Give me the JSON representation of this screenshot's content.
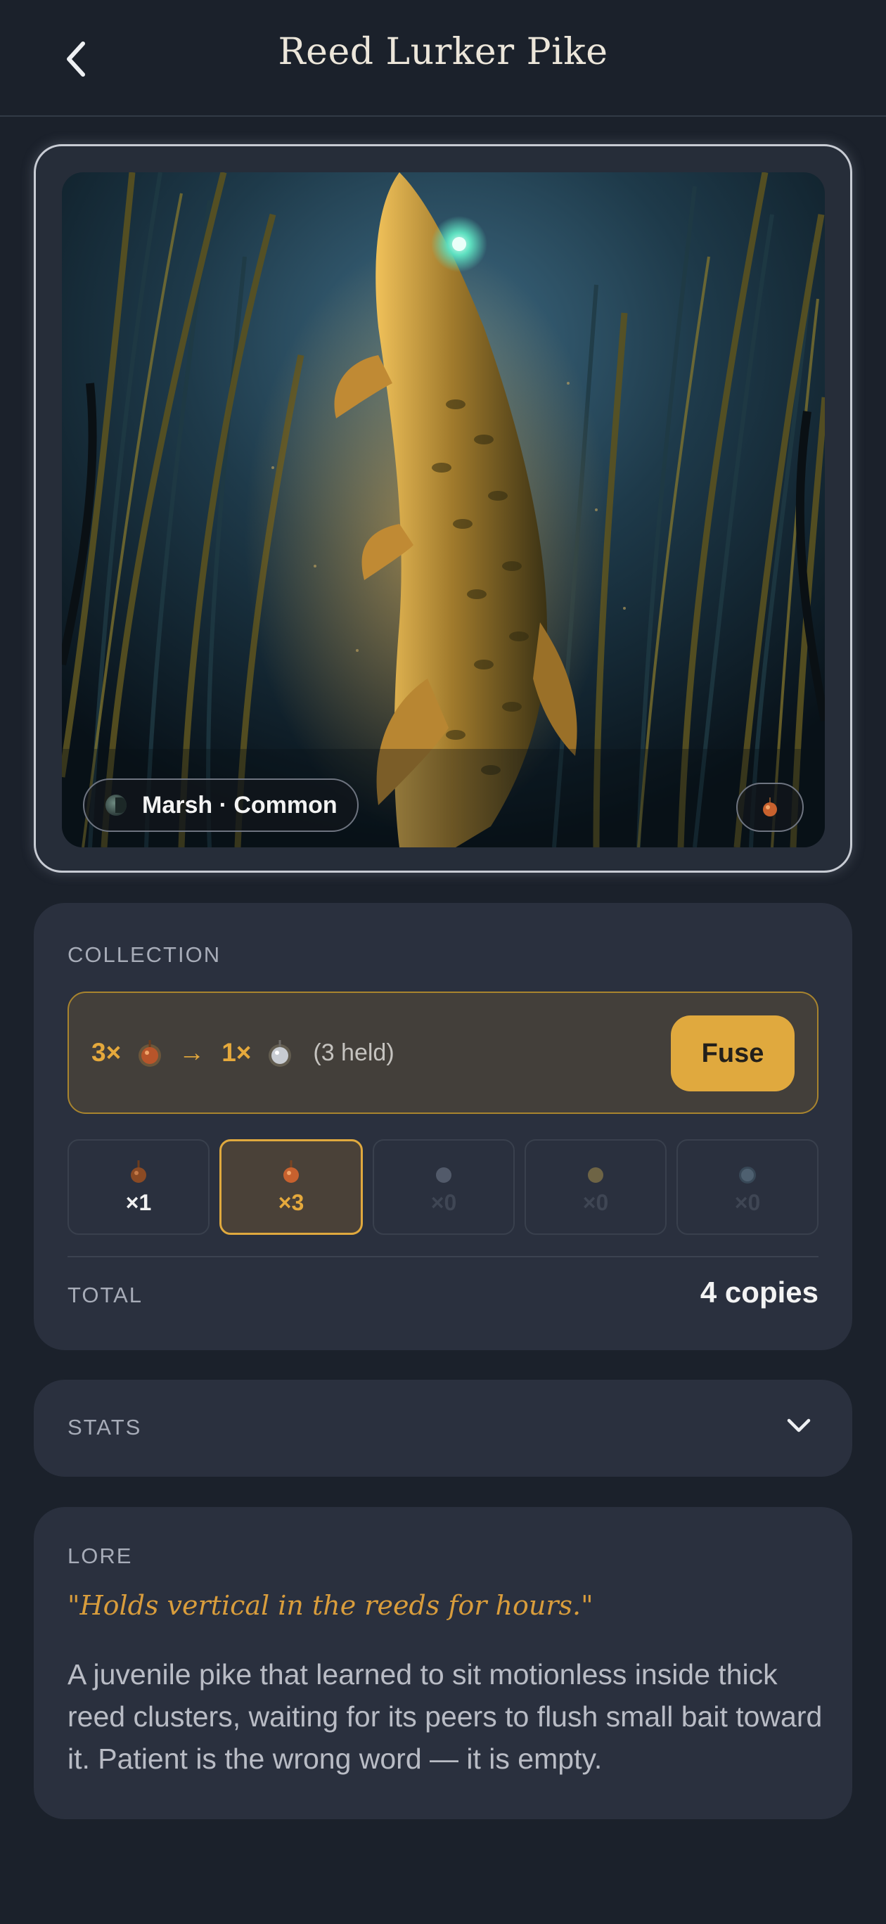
{
  "header": {
    "title": "Reed Lurker Pike"
  },
  "hero": {
    "region_label": "Marsh · Common"
  },
  "collection": {
    "section_label": "COLLECTION",
    "fuse": {
      "input_count": "3×",
      "arrow": "→",
      "output_count": "1×",
      "held_text": "(3 held)",
      "button_label": "Fuse"
    },
    "tiers": [
      {
        "count": "×1",
        "state": "owned",
        "color": "#a0552a"
      },
      {
        "count": "×3",
        "state": "selected",
        "color": "#c8612e"
      },
      {
        "count": "×0",
        "state": "empty",
        "color": "#525a6a"
      },
      {
        "count": "×0",
        "state": "empty",
        "color": "#6e6445"
      },
      {
        "count": "×0",
        "state": "empty",
        "color": "#4e6070"
      }
    ],
    "total_label": "TOTAL",
    "total_value": "4 copies"
  },
  "stats": {
    "section_label": "STATS"
  },
  "lore": {
    "section_label": "LORE",
    "quote": "\"Holds vertical in the reeds for hours.\"",
    "body": "A juvenile pike that learned to sit motionless inside thick reed clusters, waiting for its peers to flush small bait toward it. Patient is the wrong word — it is empty."
  },
  "colors": {
    "background": "#1b212b",
    "panel": "#2a303e",
    "accent": "#e0a93e",
    "quote": "#d99d3c"
  }
}
